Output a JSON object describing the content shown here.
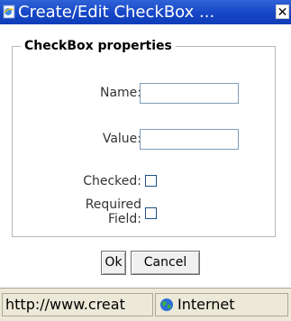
{
  "window": {
    "title": "Create/Edit CheckBox ...",
    "close_glyph": "✕"
  },
  "form": {
    "legend": "CheckBox properties",
    "name_label": "Name:",
    "name_value": "",
    "value_label": "Value:",
    "value_value": "",
    "checked_label": "Checked:",
    "checked": false,
    "required_label_line1": "Required",
    "required_label_line2": "Field:",
    "required": false
  },
  "buttons": {
    "ok_label": "Ok",
    "cancel_label": "Cancel"
  },
  "statusbar": {
    "url_text": "http://www.creat",
    "zone_text": "Internet",
    "zone_icon": "globe-icon"
  },
  "colors": {
    "titlebar": "#1646c6",
    "statusbar": "#ece9d8"
  }
}
